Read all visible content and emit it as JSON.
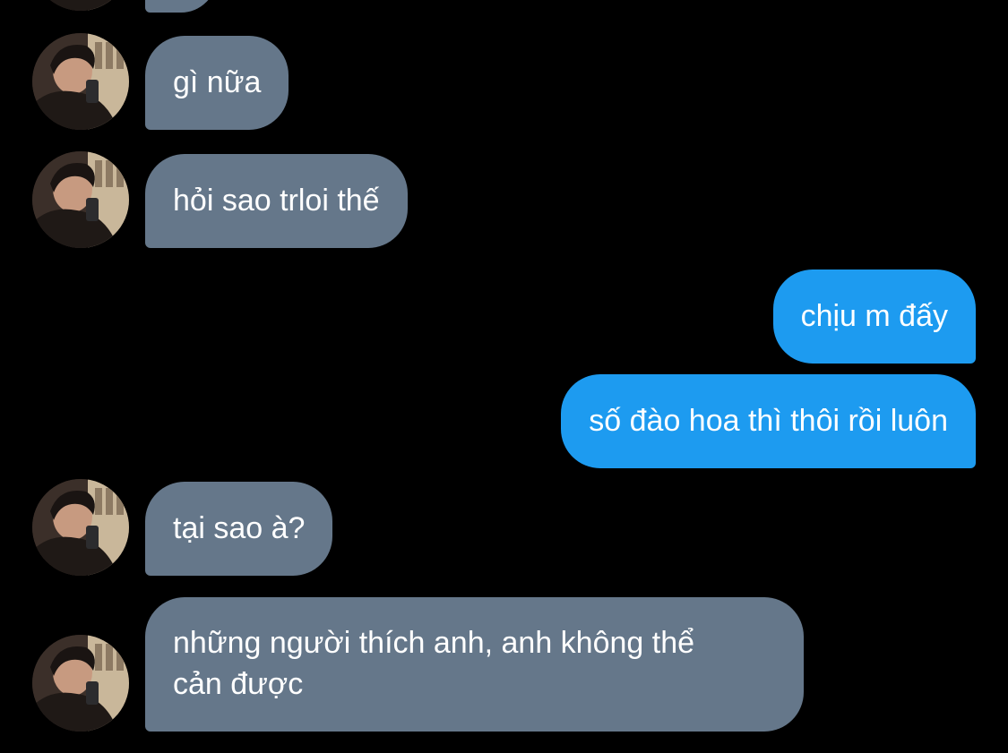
{
  "conversation": {
    "messages": [
      {
        "direction": "in",
        "text": "gì nữa"
      },
      {
        "direction": "in",
        "text": "hỏi sao trloi thế"
      },
      {
        "direction": "out",
        "text": "chịu m đấy"
      },
      {
        "direction": "out",
        "text": "số đào hoa thì thôi rồi luôn"
      },
      {
        "direction": "in",
        "text": "tại sao à?"
      },
      {
        "direction": "in",
        "text_line1": "những người thích anh, anh không thể",
        "text_line2": "cản được"
      }
    ]
  },
  "colors": {
    "background": "#000000",
    "incoming_bubble": "#65778a",
    "outgoing_bubble": "#1d9bf0",
    "text": "#ffffff"
  },
  "icons": {
    "avatar": "contact-avatar-photo"
  }
}
